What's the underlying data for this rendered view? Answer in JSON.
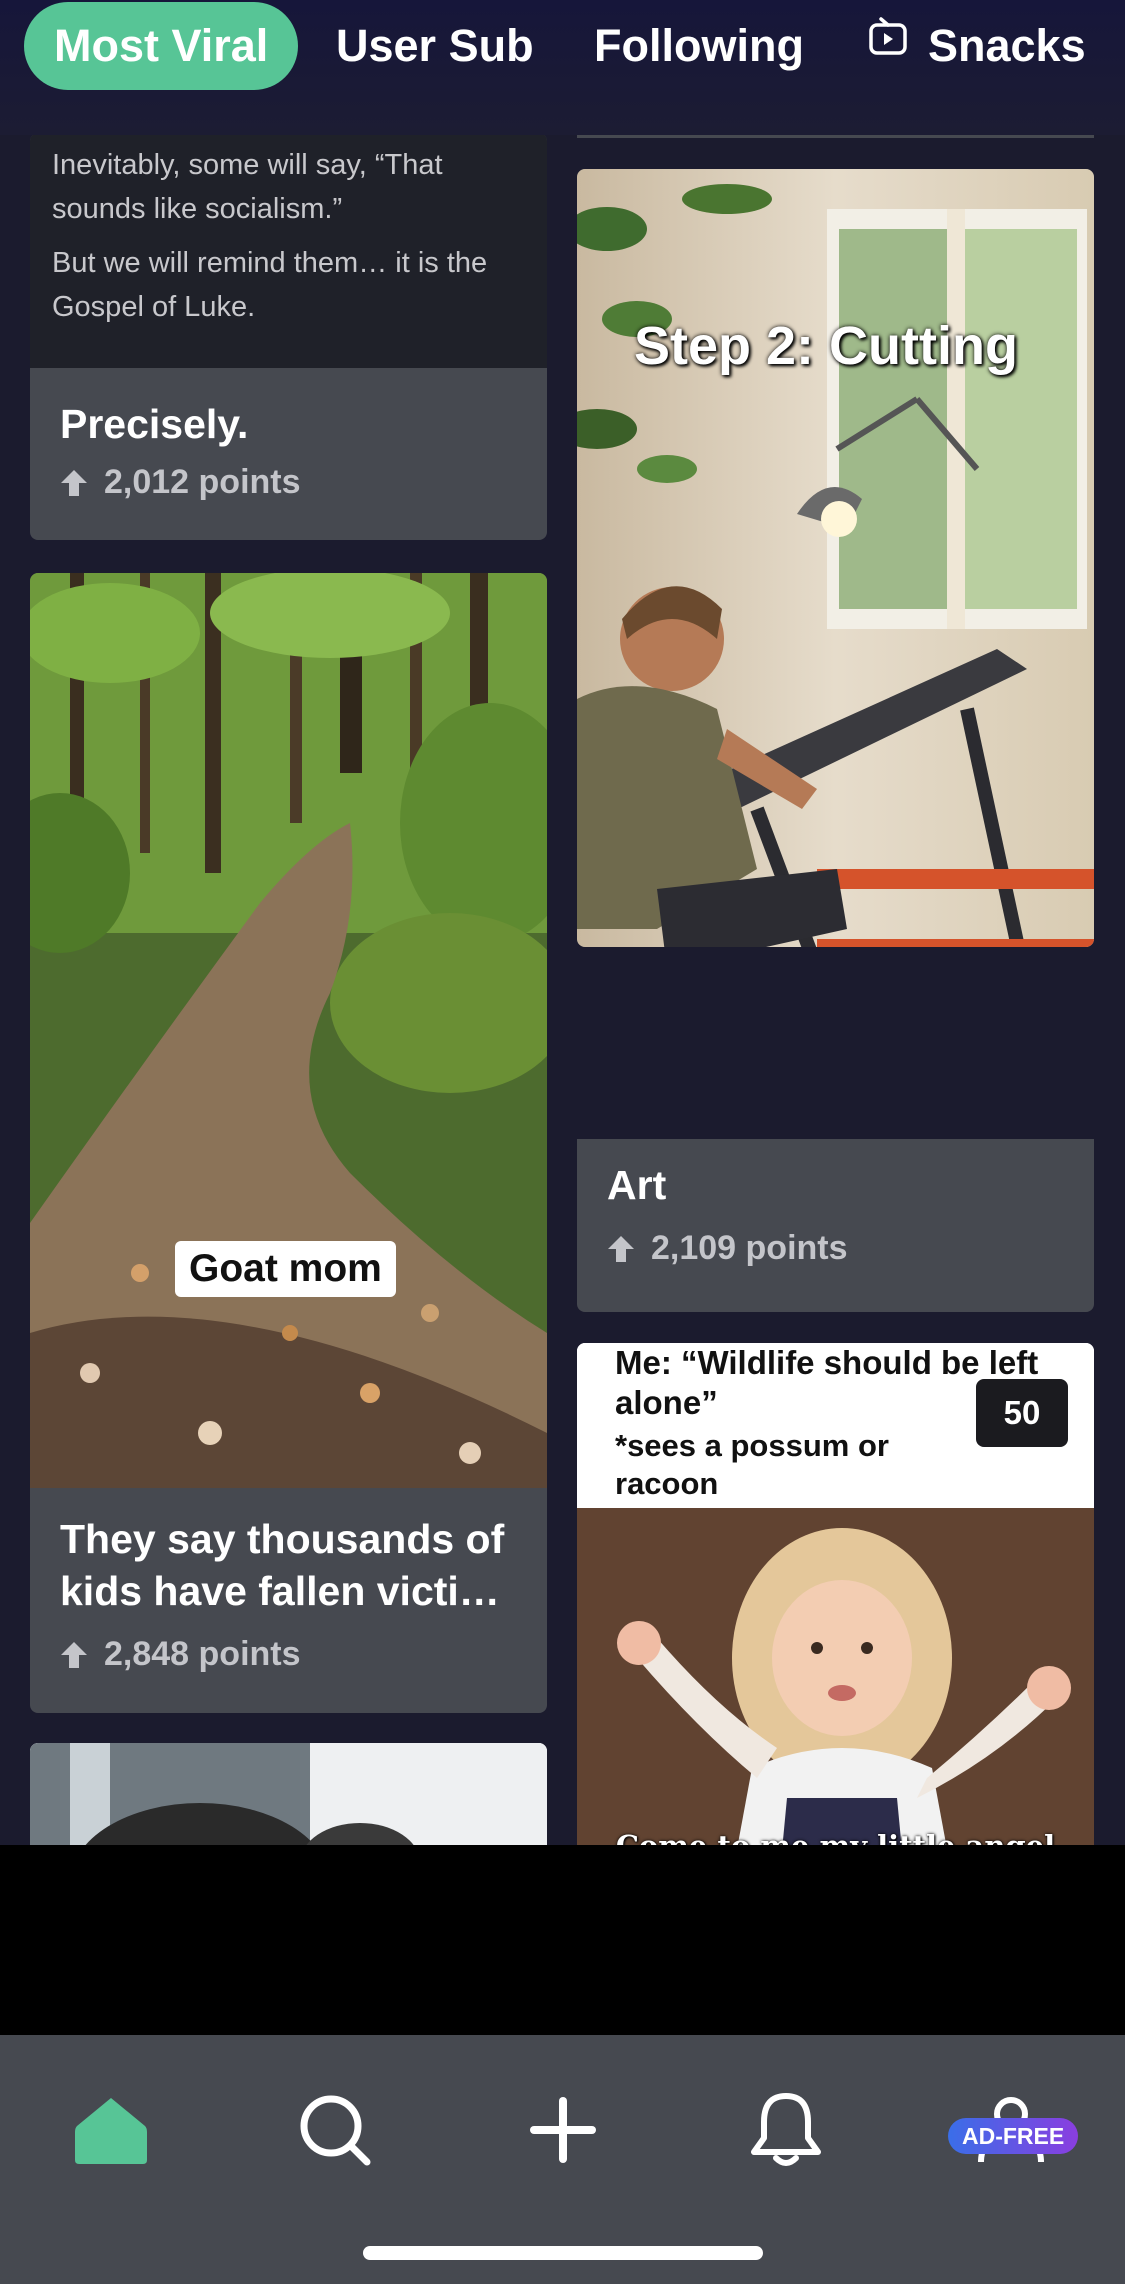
{
  "tabs": [
    {
      "label": "Most Viral",
      "active": true
    },
    {
      "label": "User Sub",
      "active": false
    },
    {
      "label": "Following",
      "active": false
    },
    {
      "label": "Snacks",
      "active": false,
      "icon": "tv-icon"
    }
  ],
  "colors": {
    "accent": "#57c596",
    "card": "#464950",
    "background": "#1b1b2e"
  },
  "posts": {
    "precisely": {
      "text_lines": [
        "Inevitably, some will say, “That sounds like socialism.”",
        "But we will remind them… it is the Gospel of Luke."
      ],
      "title": "Precisely.",
      "points": "2,012 points"
    },
    "goat": {
      "overlay": "Goat mom",
      "title": "They say thousands of kids have fallen victi…",
      "points": "2,848 points"
    },
    "art": {
      "overlay": "Step 2: Cutting",
      "title": "Art",
      "points": "2,109 points"
    },
    "meme": {
      "top_text": "Me: “Wildlife should be left alone”",
      "sub_text": "*sees a possum or racoon",
      "count": "50",
      "caption": "Come to me my little angel muffin."
    }
  },
  "bottom_nav": {
    "items": [
      "home-icon",
      "search-icon",
      "plus-icon",
      "bell-icon",
      "profile-icon"
    ],
    "badge": "AD-FREE"
  }
}
